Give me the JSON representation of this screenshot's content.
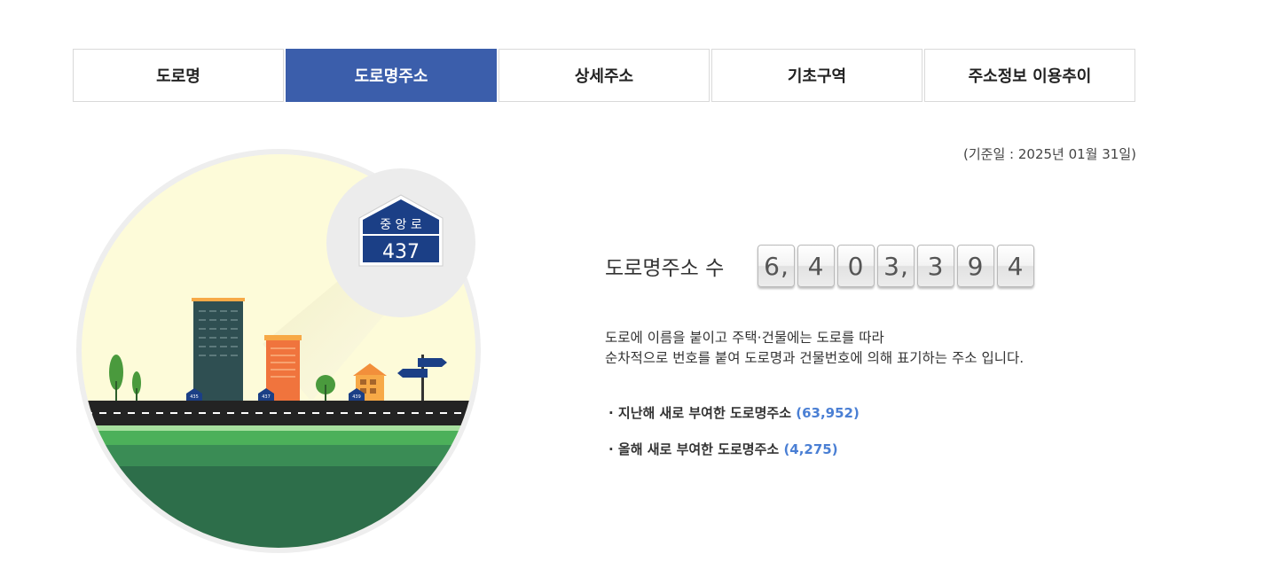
{
  "tabs": [
    {
      "label": "도로명",
      "active": false
    },
    {
      "label": "도로명주소",
      "active": true
    },
    {
      "label": "상세주소",
      "active": false
    },
    {
      "label": "기초구역",
      "active": false
    },
    {
      "label": "주소정보 이용추이",
      "active": false
    }
  ],
  "base_date": "(기준일 : 2025년 01월 31일)",
  "sign": {
    "road": "중 앙 로",
    "number": "437"
  },
  "small_signs": [
    "435",
    "437",
    "439"
  ],
  "count": {
    "label": "도로명주소 수",
    "digits": [
      {
        "d": "6",
        "comma": ","
      },
      {
        "d": "4",
        "comma": ""
      },
      {
        "d": "0",
        "comma": ""
      },
      {
        "d": "3",
        "comma": ","
      },
      {
        "d": "3",
        "comma": ""
      },
      {
        "d": "9",
        "comma": ""
      },
      {
        "d": "4",
        "comma": ""
      }
    ]
  },
  "description": {
    "line1": "도로에 이름을 붙이고 주택·건물에는 도로를 따라",
    "line2": "순차적으로 번호를 붙여 도로명과 건물번호에 의해 표기하는 주소 입니다."
  },
  "stats": {
    "last_year_label": "· 지난해 새로 부여한 도로명주소",
    "last_year_value": "(63,952)",
    "this_year_label": "· 올해 새로 부여한 도로명주소",
    "this_year_value": "(4,275)"
  },
  "colors": {
    "accent": "#3b5eab",
    "stat_number": "#4a7fd4",
    "sign_blue": "#1b3f86"
  }
}
